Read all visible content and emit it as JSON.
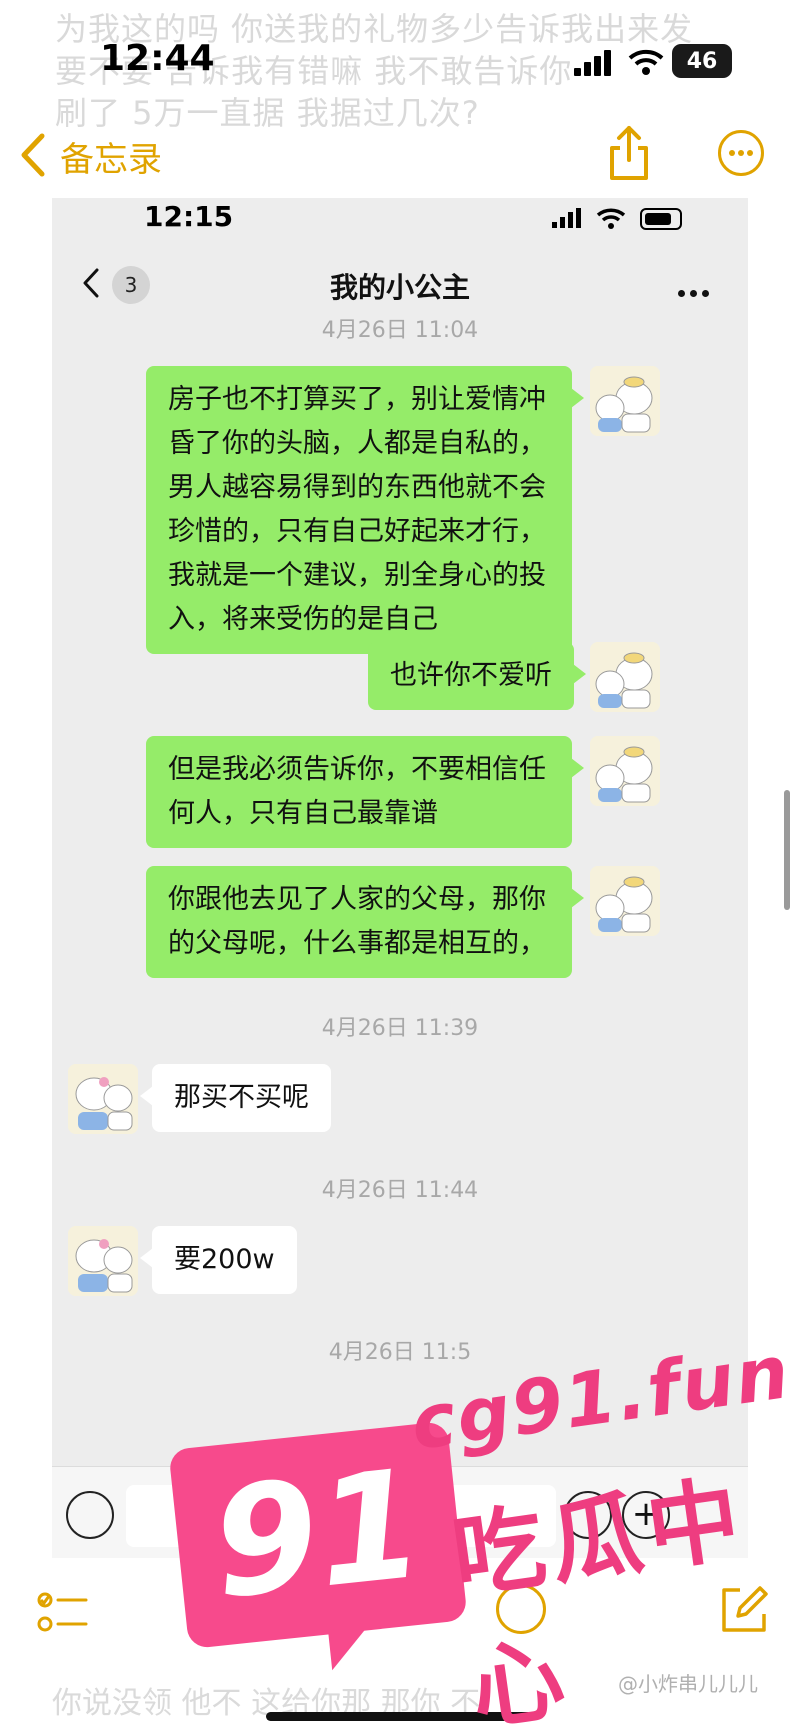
{
  "background_note": {
    "lines": [
      "为我这的吗 你送我的礼物多少告诉我出来发",
      "要不要 告诉我有错嘛 我不敢告诉你",
      "刷了 5万一直据 我据过几次?"
    ],
    "bottom_line": "你说没领 他不 这给你那 那你 不"
  },
  "outer_status": {
    "time": "12:44",
    "battery": "46"
  },
  "notes_nav": {
    "back_label": "备忘录"
  },
  "chat": {
    "status_time": "12:15",
    "unread_count": "3",
    "title": "我的小公主",
    "timestamps": [
      "4月26日 11:04",
      "4月26日 11:39",
      "4月26日 11:44",
      "4月26日 11:5"
    ],
    "messages": [
      {
        "side": "right",
        "text": "房子也不打算买了，别让爱情冲昏了你的头脑，人都是自私的，男人越容易得到的东西他就不会珍惜的，只有自己好起来才行，我就是一个建议，别全身心的投入，将来受伤的是自己"
      },
      {
        "side": "right",
        "text": "也许你不爱听"
      },
      {
        "side": "right",
        "text": "但是我必须告诉你，不要相信任何人，只有自己最靠谱"
      },
      {
        "side": "right",
        "text": "你跟他去见了人家的父母，那你的父母呢，什么事都是相互的，"
      },
      {
        "side": "left",
        "text": "那买不买呢"
      },
      {
        "side": "left",
        "text": "要200w"
      }
    ]
  },
  "watermark": {
    "number": "91",
    "domain": "cg91.fun",
    "site_name": "吃瓜中心"
  },
  "credit": "@小炸串儿儿儿",
  "colors": {
    "accent": "#e0a300",
    "bubble_green": "#95ec69",
    "watermark_pink": "#f74a8c"
  }
}
